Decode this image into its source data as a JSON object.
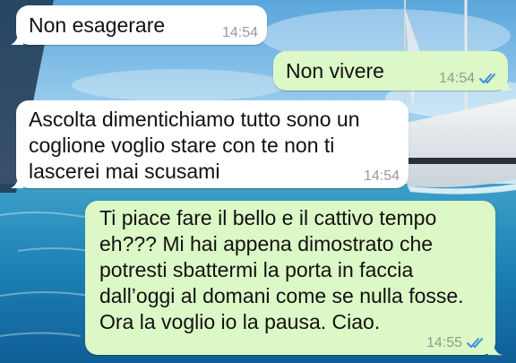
{
  "messages": [
    {
      "id": "b1",
      "direction": "incoming",
      "text": "Non esagerare",
      "time": "14:54",
      "read": false
    },
    {
      "id": "b2",
      "direction": "outgoing",
      "text": "Non vivere",
      "time": "14:54",
      "read": true
    },
    {
      "id": "b3",
      "direction": "incoming",
      "text": "Ascolta dimentichiamo tutto sono un coglione voglio stare con te non ti lascerei mai scusami",
      "time": "14:54",
      "read": false
    },
    {
      "id": "b4",
      "direction": "outgoing",
      "text": "Ti piace fare il bello e il cattivo tempo eh??? Mi hai appena dimostrato che potresti sbattermi la porta in faccia dall’oggi al domani come se nulla fosse. Ora la voglio io la pausa. Ciao.",
      "time": "14:55",
      "read": true
    }
  ],
  "colors": {
    "incoming_bubble": "#ffffff",
    "outgoing_bubble": "#dcf8c6",
    "read_tick": "#3d8fd6",
    "timestamp": "#9a9a9a"
  },
  "icons": {
    "read_receipt": "double-check-icon"
  }
}
